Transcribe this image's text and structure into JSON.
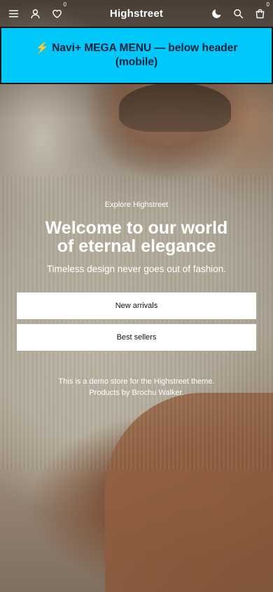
{
  "header": {
    "logo": "Highstreet",
    "wishlist_count": "0",
    "cart_count": "0",
    "icons": [
      "menu-icon",
      "account-icon",
      "heart-icon",
      "moon-icon",
      "search-icon",
      "bag-icon"
    ]
  },
  "banner": {
    "text": "⚡ Navi+ MEGA MENU — below header (mobile)",
    "color": "#00c8fb"
  },
  "hero": {
    "eyebrow": "Explore Highstreet",
    "title": "Welcome to our world of eternal elegance",
    "subtitle": "Timeless design never goes out of fashion.",
    "buttons": [
      {
        "label": "New arrivals"
      },
      {
        "label": "Best sellers"
      }
    ],
    "note_line1": "This is a demo store for the Highstreet theme.",
    "note_line2": "Products by Brochu Walker."
  }
}
